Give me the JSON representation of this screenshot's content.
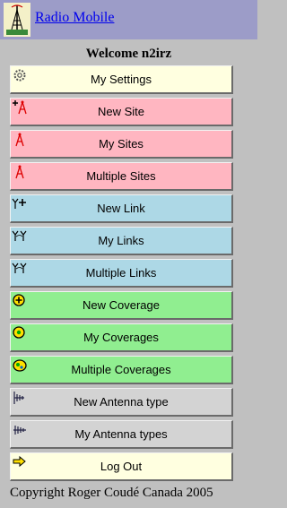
{
  "header": {
    "app_title": "Radio Mobile",
    "logo_icon": "antenna-tower-icon",
    "background": "#9c9cc8"
  },
  "welcome_text": "Welcome n2irz",
  "menu": [
    {
      "label": "My Settings",
      "icon": "gear-icon",
      "color": "#ffffe0"
    },
    {
      "label": "New Site",
      "icon": "new-site-icon",
      "color": "#ffb6c1"
    },
    {
      "label": "My Sites",
      "icon": "site-icon",
      "color": "#ffb6c1"
    },
    {
      "label": "Multiple Sites",
      "icon": "site-icon",
      "color": "#ffb6c1"
    },
    {
      "label": "New Link",
      "icon": "new-link-icon",
      "color": "#add8e6"
    },
    {
      "label": "My Links",
      "icon": "link-icon",
      "color": "#add8e6"
    },
    {
      "label": "Multiple Links",
      "icon": "link-icon",
      "color": "#add8e6"
    },
    {
      "label": "New Coverage",
      "icon": "new-coverage-icon",
      "color": "#90ee90"
    },
    {
      "label": "My Coverages",
      "icon": "coverage-icon",
      "color": "#90ee90"
    },
    {
      "label": "Multiple Coverages",
      "icon": "multiple-coverage-icon",
      "color": "#90ee90"
    },
    {
      "label": "New Antenna type",
      "icon": "new-antenna-icon",
      "color": "#d3d3d3"
    },
    {
      "label": "My Antenna types",
      "icon": "antenna-icon",
      "color": "#d3d3d3"
    },
    {
      "label": "Log Out",
      "icon": "logout-arrow-icon",
      "color": "#ffffe0"
    }
  ],
  "footer_text": "Copyright Roger Coudé Canada 2005"
}
